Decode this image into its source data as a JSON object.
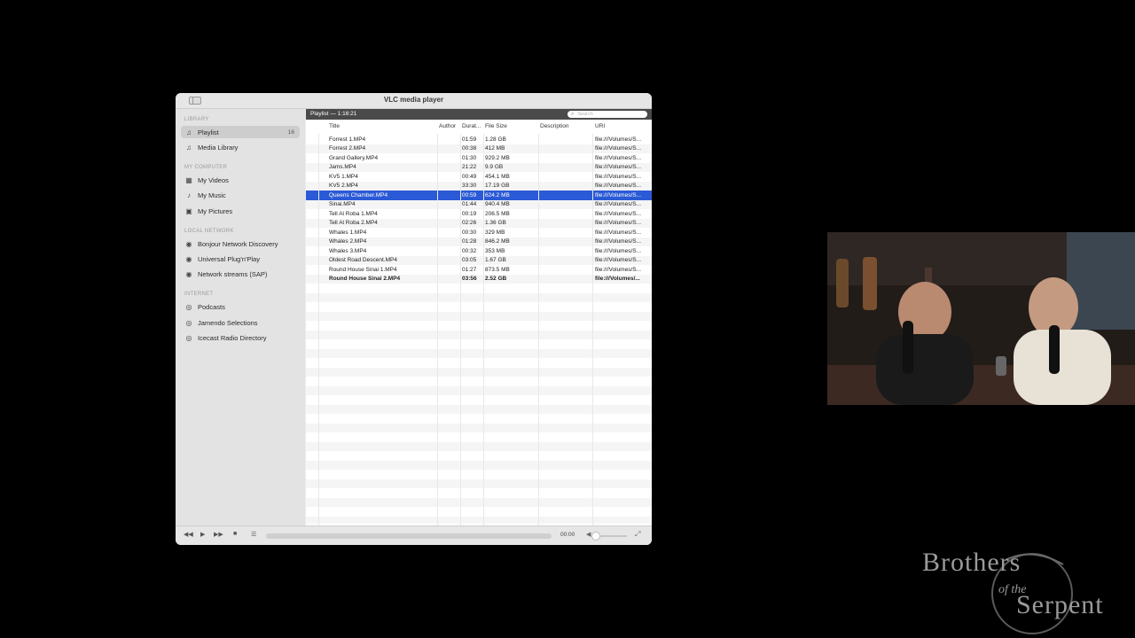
{
  "window": {
    "title": "VLC media player"
  },
  "sidebar": {
    "sections": {
      "library": "LIBRARY",
      "my_computer": "MY COMPUTER",
      "local_network": "LOCAL NETWORK",
      "internet": "INTERNET"
    },
    "items": [
      {
        "label": "Playlist",
        "count": "16",
        "icon": "playlist-icon"
      },
      {
        "label": "Media Library",
        "icon": "media-library-icon"
      },
      {
        "label": "My Videos",
        "icon": "film-icon"
      },
      {
        "label": "My Music",
        "icon": "music-note-icon"
      },
      {
        "label": "My Pictures",
        "icon": "picture-icon"
      },
      {
        "label": "Bonjour Network Discovery",
        "icon": "network-globe-icon"
      },
      {
        "label": "Universal Plug'n'Play",
        "icon": "network-globe-icon"
      },
      {
        "label": "Network streams (SAP)",
        "icon": "network-globe-icon"
      },
      {
        "label": "Podcasts",
        "icon": "broadcast-icon"
      },
      {
        "label": "Jamendo Selections",
        "icon": "broadcast-icon"
      },
      {
        "label": "Icecast Radio Directory",
        "icon": "broadcast-icon"
      }
    ]
  },
  "playlist": {
    "header": "Playlist — 1:16:21",
    "search_placeholder": "Search",
    "columns": {
      "title": "Title",
      "author": "Author",
      "duration": "Durat...",
      "size": "File Size",
      "description": "Description",
      "uri": "URI"
    },
    "rows": [
      {
        "title": "Forrest 1.MP4",
        "duration": "01:59",
        "size": "1.28 GB",
        "uri": "file:///Volumes/S..."
      },
      {
        "title": "Forrest 2.MP4",
        "duration": "00:38",
        "size": "412 MB",
        "uri": "file:///Volumes/S..."
      },
      {
        "title": "Grand Gallery.MP4",
        "duration": "01:30",
        "size": "929.2 MB",
        "uri": "file:///Volumes/S..."
      },
      {
        "title": "Jams.MP4",
        "duration": "21:22",
        "size": "9.9 GB",
        "uri": "file:///Volumes/S..."
      },
      {
        "title": "KV5 1.MP4",
        "duration": "00:49",
        "size": "454.1 MB",
        "uri": "file:///Volumes/S..."
      },
      {
        "title": "KV5 2.MP4",
        "duration": "33:30",
        "size": "17.19 GB",
        "uri": "file:///Volumes/S..."
      },
      {
        "title": "Queens Chamber.MP4",
        "duration": "00:59",
        "size": "624.2 MB",
        "uri": "file:///Volumes/S..."
      },
      {
        "title": "Sinai.MP4",
        "duration": "01:44",
        "size": "940.4 MB",
        "uri": "file:///Volumes/S..."
      },
      {
        "title": "Tell Al Roba 1.MP4",
        "duration": "00:19",
        "size": "206.5 MB",
        "uri": "file:///Volumes/S..."
      },
      {
        "title": "Tell Al Roba 2.MP4",
        "duration": "02:26",
        "size": "1.36 GB",
        "uri": "file:///Volumes/S..."
      },
      {
        "title": "Whales 1.MP4",
        "duration": "00:30",
        "size": "329 MB",
        "uri": "file:///Volumes/S..."
      },
      {
        "title": "Whales 2.MP4",
        "duration": "01:28",
        "size": "846.2 MB",
        "uri": "file:///Volumes/S..."
      },
      {
        "title": "Whales 3.MP4",
        "duration": "00:32",
        "size": "353 MB",
        "uri": "file:///Volumes/S..."
      },
      {
        "title": "Oldest Road Descent.MP4",
        "duration": "03:05",
        "size": "1.67 GB",
        "uri": "file:///Volumes/S..."
      },
      {
        "title": "Round House Sinai 1.MP4",
        "duration": "01:27",
        "size": "873.5 MB",
        "uri": "file:///Volumes/S..."
      },
      {
        "title": "Round House Sinai 2.MP4",
        "duration": "03:56",
        "size": "2.52 GB",
        "uri": "file:///Volumes/..."
      }
    ],
    "selected_row": "Queens Chamber.MP4",
    "playing_row": "Round House Sinai 2.MP4"
  },
  "controls": {
    "time": "00:00",
    "progress": 0,
    "volume": 0.2
  },
  "colors": {
    "selection": "#2b5ad6",
    "header_bar": "#4a4a4a"
  },
  "logo": {
    "line1": "Brothers",
    "line2": "of the",
    "line3": "Serpent"
  }
}
